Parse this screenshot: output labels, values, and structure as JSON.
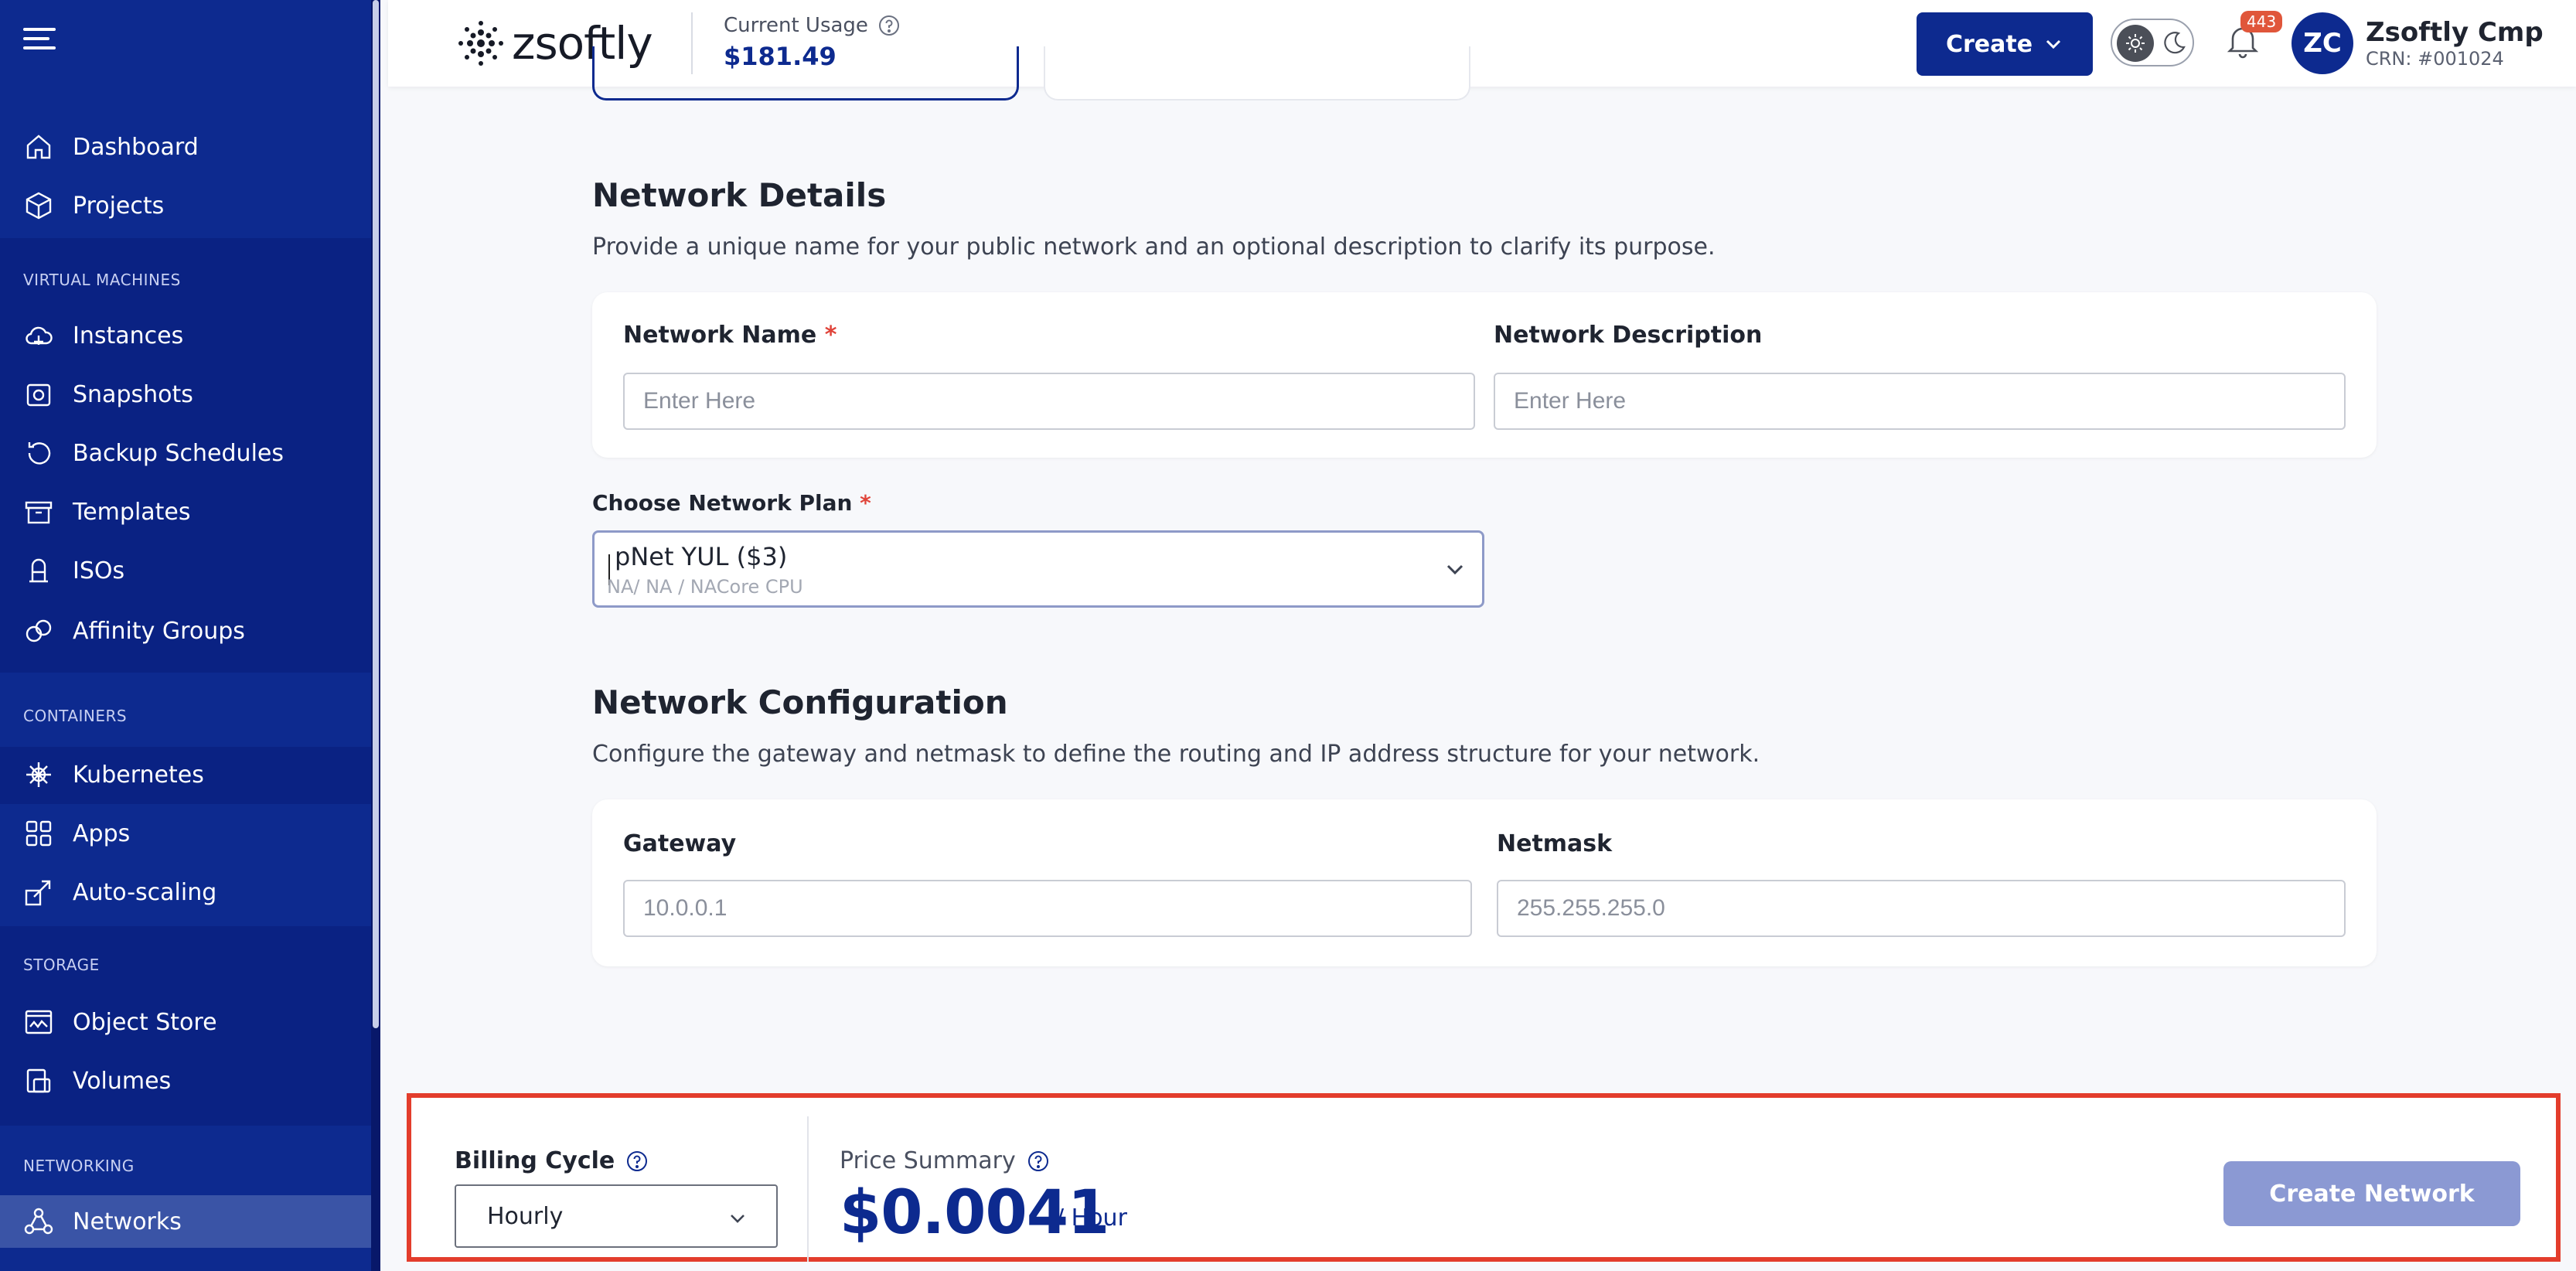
{
  "header": {
    "brand": "zsoftly",
    "usage_label": "Current Usage",
    "usage_value": "$181.49",
    "create_label": "Create",
    "notifications_count": "443",
    "user_initials": "ZC",
    "user_name": "Zsoftly Cmp",
    "user_crn": "CRN: #001024"
  },
  "sidebar": {
    "top_items": [
      {
        "label": "Dashboard",
        "icon": "home-icon"
      },
      {
        "label": "Projects",
        "icon": "cube-icon"
      }
    ],
    "sections": [
      {
        "title": "VIRTUAL MACHINES",
        "items": [
          {
            "label": "Instances",
            "icon": "cloud-icon"
          },
          {
            "label": "Snapshots",
            "icon": "camera-icon"
          },
          {
            "label": "Backup Schedules",
            "icon": "history-icon"
          },
          {
            "label": "Templates",
            "icon": "archive-icon"
          },
          {
            "label": "ISOs",
            "icon": "disc-icon"
          },
          {
            "label": "Affinity Groups",
            "icon": "affinity-icon"
          }
        ]
      },
      {
        "title": "CONTAINERS",
        "items": [
          {
            "label": "Kubernetes",
            "icon": "helm-icon"
          },
          {
            "label": "Apps",
            "icon": "apps-grid-icon"
          },
          {
            "label": "Auto-scaling",
            "icon": "scale-icon"
          }
        ]
      },
      {
        "title": "STORAGE",
        "items": [
          {
            "label": "Object Store",
            "icon": "object-store-icon"
          },
          {
            "label": "Volumes",
            "icon": "volumes-icon"
          }
        ]
      },
      {
        "title": "NETWORKING",
        "items": [
          {
            "label": "Networks",
            "icon": "network-icon"
          }
        ]
      }
    ]
  },
  "network_details": {
    "title": "Network Details",
    "description": "Provide a unique name for your public network and an optional description to clarify its purpose.",
    "name_label": "Network Name",
    "name_placeholder": "Enter Here",
    "desc_label": "Network Description",
    "desc_placeholder": "Enter Here"
  },
  "plan": {
    "label": "Choose Network Plan",
    "selected": "pNet YUL ($3)",
    "sub": "NA/ NA / NACore CPU"
  },
  "network_config": {
    "title": "Network Configuration",
    "description": "Configure the gateway and netmask to define the routing and IP address structure for your network.",
    "gateway_label": "Gateway",
    "gateway_placeholder": "10.0.0.1",
    "netmask_label": "Netmask",
    "netmask_placeholder": "255.255.255.0"
  },
  "footer": {
    "billing_label": "Billing Cycle",
    "billing_value": "Hourly",
    "price_label": "Price Summary",
    "price_value": "$0.0041",
    "price_unit": "/ Hour",
    "create_network_label": "Create Network"
  },
  "colors": {
    "brand_navy": "#0d2a8f",
    "highlight_border": "#e33d2c",
    "required": "#e0443a",
    "button_disabled": "#8b99d3"
  }
}
